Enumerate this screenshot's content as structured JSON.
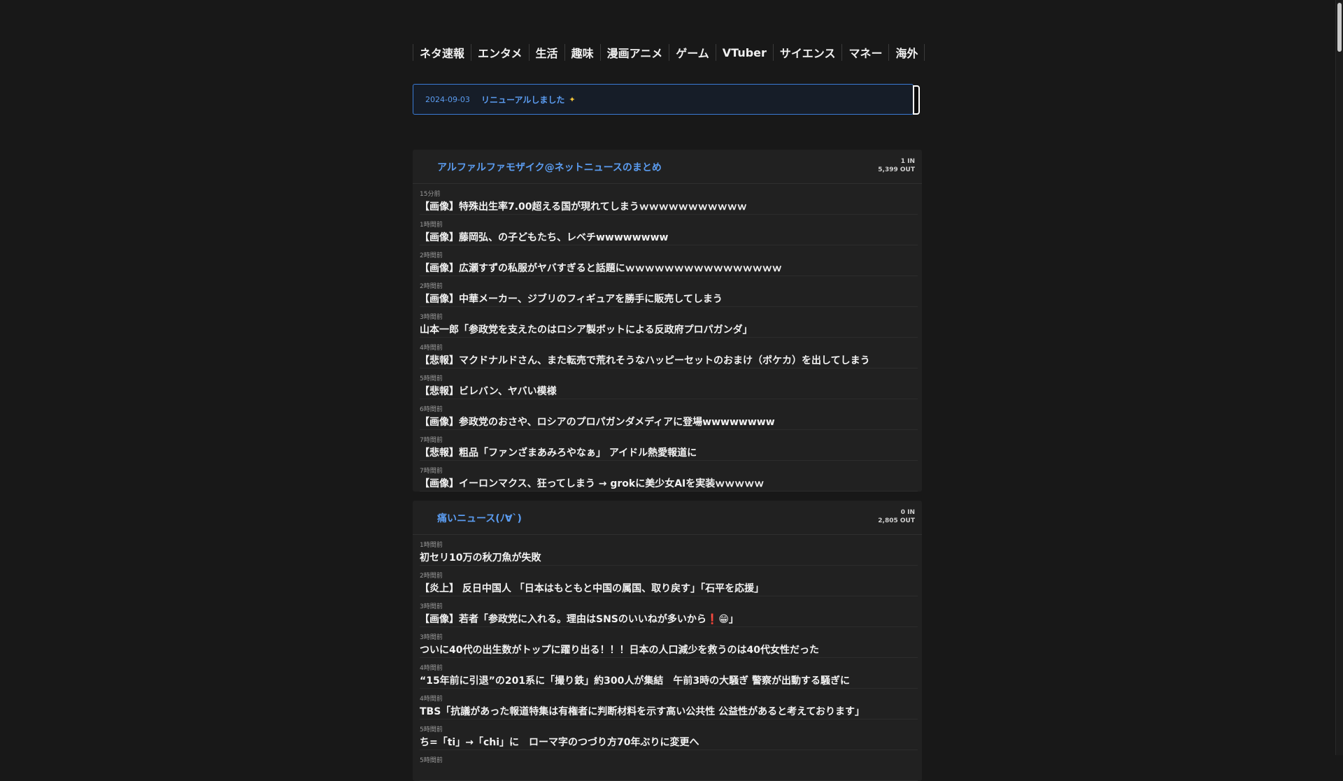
{
  "nav": [
    {
      "label": "ネタ速報"
    },
    {
      "label": "エンタメ"
    },
    {
      "label": "生活"
    },
    {
      "label": "趣味"
    },
    {
      "label": "漫画アニメ"
    },
    {
      "label": "ゲーム"
    },
    {
      "label": "VTuber"
    },
    {
      "label": "サイエンス"
    },
    {
      "label": "マネー"
    },
    {
      "label": "海外"
    }
  ],
  "notice": {
    "date": "2024-09-03",
    "text": "リニューアルしました",
    "icon": "sparkle-icon"
  },
  "feeds": [
    {
      "title": "アルファルファモザイク@ネットニュースのまとめ",
      "stat_in": "1 IN",
      "stat_out": "5,399 OUT",
      "items": [
        {
          "time": "15分前",
          "title": "【画像】特殊出生率7.00超える国が現れてしまうｗｗｗｗｗｗｗｗｗｗｗ"
        },
        {
          "time": "1時間前",
          "title": "【画像】藤岡弘、の子どもたち、レベチwwwwwwww"
        },
        {
          "time": "2時間前",
          "title": "【画像】広瀬すずの私服がヤバすぎると話題にｗｗｗｗｗｗｗｗｗｗｗｗｗｗｗｗ"
        },
        {
          "time": "2時間前",
          "title": "【画像】中華メーカー、ジブリのフィギュアを勝手に販売してしまう"
        },
        {
          "time": "3時間前",
          "title": "山本一郎「参政党を支えたのはロシア製ボットによる反政府プロパガンダ」"
        },
        {
          "time": "4時間前",
          "title": "【悲報】マクドナルドさん、また転売で荒れそうなハッピーセットのおまけ（ポケカ）を出してしまう"
        },
        {
          "time": "5時間前",
          "title": "【悲報】ビレバン、ヤバい模様"
        },
        {
          "time": "6時間前",
          "title": "【画像】参政党のおさや、ロシアのプロパガンダメディアに登場wwwwwwww"
        },
        {
          "time": "7時間前",
          "title": "【悲報】粗品「ファンざまあみろやなぁ」 アイドル熱愛報道に"
        },
        {
          "time": "7時間前",
          "title": "【画像】イーロンマクス、狂ってしまう → grokに美少女AIを実装ｗｗｗｗｗ"
        }
      ]
    },
    {
      "title": "痛いニュース(ﾉ∀`)",
      "stat_in": "0 IN",
      "stat_out": "2,805 OUT",
      "items": [
        {
          "time": "1時間前",
          "title": "初セリ10万の秋刀魚が失敗"
        },
        {
          "time": "2時間前",
          "title": "【炎上】 反日中国人 「日本はもともと中国の属国、取り戻す」「石平を応援」"
        },
        {
          "time": "3時間前",
          "title": "【画像】若者「参政党に入れる。理由はSNSのいいねが多いから❗😁」"
        },
        {
          "time": "3時間前",
          "title": "ついに40代の出生数がトップに躍り出る！！！日本の人口減少を救うのは40代女性だった"
        },
        {
          "time": "4時間前",
          "title": "“15年前に引退”の201系に「撮り鉄」約300人が集結　午前3時の大騒ぎ 警察が出動する騒ぎに"
        },
        {
          "time": "4時間前",
          "title": "TBS「抗議があった報道特集は有権者に判断材料を示す高い公共性 公益性があると考えております」"
        },
        {
          "time": "5時間前",
          "title": "ち=「ti」→「chi」に　ローマ字のつづり方70年ぶりに変更へ"
        },
        {
          "time": "5時間前",
          "title": ""
        }
      ]
    }
  ]
}
